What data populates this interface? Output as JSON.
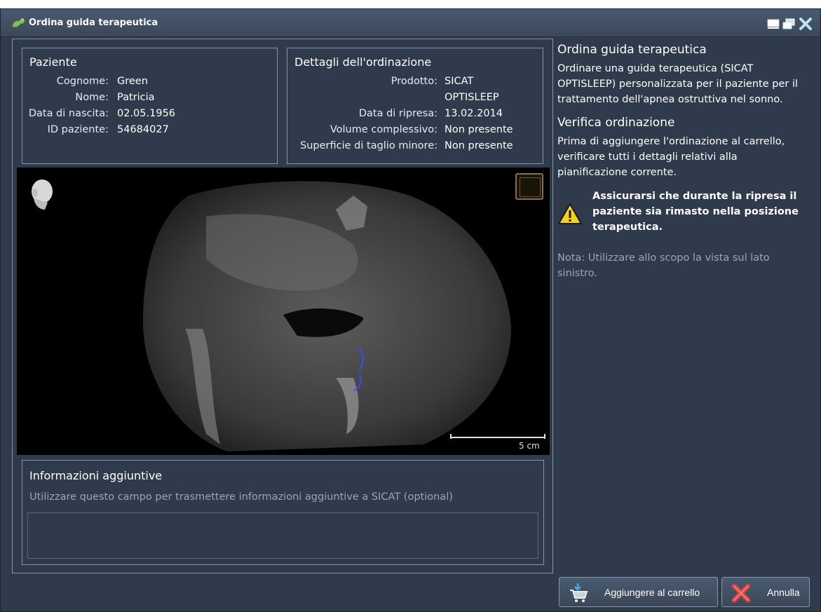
{
  "window": {
    "title": "Ordina guida terapeutica"
  },
  "patient": {
    "title": "Paziente",
    "fields": [
      {
        "label": "Cognome:",
        "value": "Green"
      },
      {
        "label": "Nome:",
        "value": "Patricia"
      },
      {
        "label": "Data di nascita:",
        "value": "02.05.1956"
      },
      {
        "label": "ID paziente:",
        "value": "54684027"
      }
    ]
  },
  "order": {
    "title": "Dettagli dell'ordinazione",
    "product_label": "Prodotto:",
    "product_line1": "SICAT",
    "product_line2": "OPTISLEEP",
    "scan_date_label": "Data di ripresa:",
    "scan_date": "13.02.2014",
    "volume_label": "Volume complessivo:",
    "volume": "Non presente",
    "cut_label": "Superficie di taglio minore:",
    "cut": "Non presente"
  },
  "viewer": {
    "scale_label": "5 cm"
  },
  "additional_info": {
    "title": "Informazioni aggiuntive",
    "hint": "Utilizzare questo campo per trasmettere informazioni aggiuntive a SICAT (optional)",
    "value": ""
  },
  "side": {
    "heading1": "Ordina guida terapeutica",
    "text1": "Ordinare una guida terapeutica (SICAT OPTISLEEP) personalizzata per il paziente per il trattamento dell'apnea ostruttiva nel sonno.",
    "heading2": "Verifica ordinazione",
    "text2": "Prima di aggiungere l'ordinazione al carrello, verificare tutti i dettagli relativi alla pianificazione corrente.",
    "warning": "Assicurarsi che durante la ripresa il paziente sia rimasto nella posizione terapeutica.",
    "note": "Nota: Utilizzare allo scopo la vista sul lato sinistro."
  },
  "buttons": {
    "add_to_cart": "Aggiungere al carrello",
    "cancel": "Annulla"
  },
  "colors": {
    "background": "#2f3b4c",
    "border": "#8a96a6",
    "muted_text": "#9aa6b4",
    "warning_yellow": "#f2d31a",
    "cancel_red": "#d94040"
  },
  "icons": {
    "title": "tooth-icon",
    "minimize": "minimize-icon",
    "restore": "restore-icon",
    "close": "close-icon",
    "warning": "warning-icon",
    "cart": "cart-icon",
    "cancel": "cancel-x-icon",
    "head": "head-orientation-icon"
  }
}
